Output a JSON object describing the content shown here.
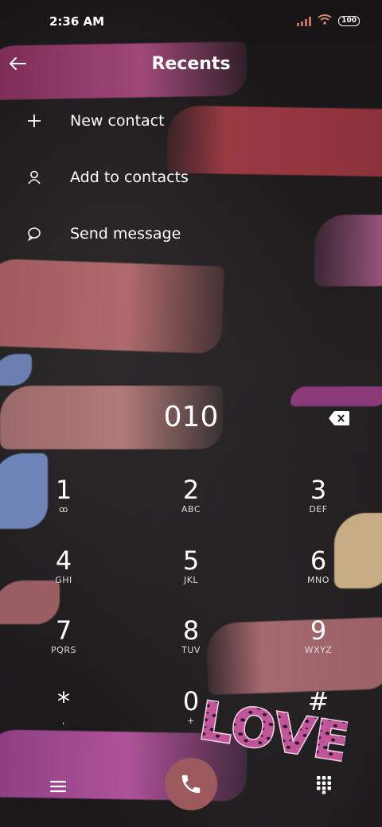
{
  "status_bar": {
    "time": "2:36 AM",
    "battery": "100",
    "icons": [
      "signal-icon",
      "wifi-icon",
      "battery-icon"
    ]
  },
  "header": {
    "title": "Recents",
    "back_icon": "back-arrow-icon"
  },
  "menu": [
    {
      "label": "New contact",
      "icon": "plus-icon"
    },
    {
      "label": "Add to contacts",
      "icon": "person-icon"
    },
    {
      "label": "Send message",
      "icon": "message-bubble-icon"
    }
  ],
  "dialer": {
    "number": "010",
    "backspace_icon": "backspace-icon",
    "keys": [
      {
        "digit": "1",
        "letters": "ꝏ"
      },
      {
        "digit": "2",
        "letters": "ABC"
      },
      {
        "digit": "3",
        "letters": "DEF"
      },
      {
        "digit": "4",
        "letters": "GHI"
      },
      {
        "digit": "5",
        "letters": "JKL"
      },
      {
        "digit": "6",
        "letters": "MNO"
      },
      {
        "digit": "7",
        "letters": "PQRS"
      },
      {
        "digit": "8",
        "letters": "TUV"
      },
      {
        "digit": "9",
        "letters": "WXYZ"
      },
      {
        "digit": "*",
        "letters": ","
      },
      {
        "digit": "0",
        "letters": "+"
      },
      {
        "digit": "#",
        "letters": ""
      }
    ]
  },
  "bottom_bar": {
    "icons": [
      "menu-icon",
      "phone-icon",
      "dialpad-icon"
    ]
  },
  "wallpaper": {
    "sticker_text": "LOVE",
    "colors": {
      "call_button": "#9c5a5e",
      "sticker": "#c0559a"
    }
  }
}
